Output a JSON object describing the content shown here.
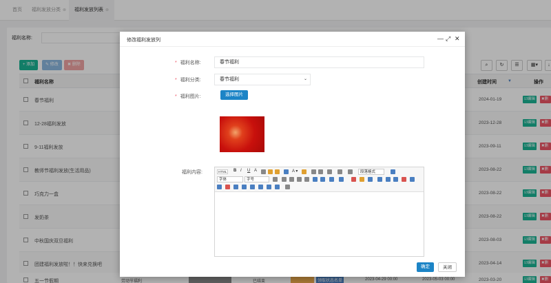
{
  "tabs": [
    {
      "label": "首页"
    },
    {
      "label": "福利发放分类",
      "close": "⊗"
    },
    {
      "label": "福利发放列表",
      "close": "⊗"
    }
  ],
  "search": {
    "label": "福利名称:"
  },
  "toolbar": {
    "add": "+ 添加",
    "edit": "✎ 修改",
    "delete": "✖ 删除"
  },
  "table": {
    "headers": {
      "name": "福利名称",
      "created": "创建时间",
      "actions": "操作"
    },
    "rows": [
      {
        "name": "春节福利",
        "date": "2024-01-19"
      },
      {
        "name": "12-28福利发放",
        "date": "2023-12-28"
      },
      {
        "name": "9-11福利发放",
        "date": "2023-09-11"
      },
      {
        "name": "教师节福利发放(生活用品)",
        "date": "2023-08-22"
      },
      {
        "name": "巧克力一盒",
        "date": "2023-08-22"
      },
      {
        "name": "发奶茶",
        "date": "2023-08-22"
      },
      {
        "name": "中秋国庆双旦福利",
        "date": "2023-08-03"
      },
      {
        "name": "团建福利发放啦！！快来兑换吧",
        "date": "2023-04-14"
      },
      {
        "name": "五一节假期",
        "date": "2023-03-20",
        "category": "劳动节福利",
        "status": "已结束",
        "start": "2023-04-29 00:00",
        "end": "2023-05-03 00:00",
        "list_btn": "领取状态名单"
      }
    ],
    "action_edit": "☑编辑",
    "action_delete": "✖删除"
  },
  "modal": {
    "title": "修改福利发放列",
    "fields": {
      "name_label": "福利名称:",
      "name_value": "春节福利",
      "category_label": "福利分类:",
      "category_value": "春节福利",
      "image_label": "福利图片:",
      "image_button": "选择图片",
      "content_label": "福利内容:"
    },
    "editor": {
      "html": "HTML",
      "para": "段落格式",
      "font": "字体",
      "size": "字号"
    },
    "ok": "确定",
    "close": "关闭"
  }
}
